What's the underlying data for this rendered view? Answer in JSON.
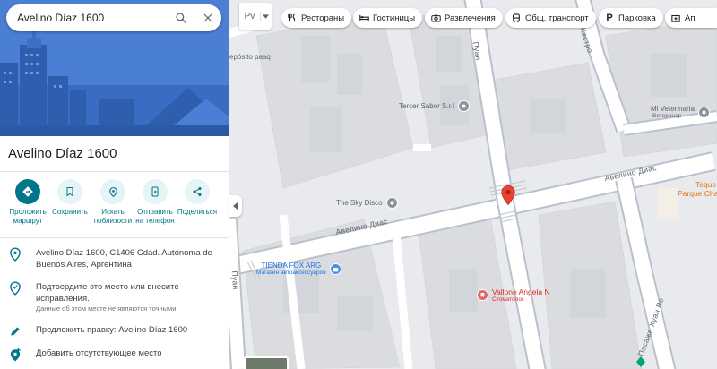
{
  "search": {
    "query": "Avelino Díaz 1600"
  },
  "place": {
    "title": "Avelino Díaz 1600"
  },
  "actions": [
    {
      "label": "Проложить\nмаршрут",
      "icon": "directions-icon"
    },
    {
      "label": "Сохранить",
      "icon": "bookmark-icon"
    },
    {
      "label": "Искать\nпоблизости",
      "icon": "nearby-icon"
    },
    {
      "label": "Отправить\nна телефон",
      "icon": "send-to-phone-icon"
    },
    {
      "label": "Поделиться",
      "icon": "share-icon"
    }
  ],
  "info": {
    "address": "Avelino Díaz 1600, C1406 Cdad. Autónoma de Buenos Aires, Аргентина",
    "confirm": "Подтвердите это место или внесите исправления.",
    "confirm_note": "Данные об этом месте не являются точными.",
    "suggest": "Предложить правку: Avelino Díaz 1600",
    "add_place": "Добавить отсутствующее место"
  },
  "map": {
    "layer_label": "Pv",
    "chips": [
      {
        "label": "Рестораны",
        "icon": "restaurant-icon"
      },
      {
        "label": "Гостиницы",
        "icon": "hotel-icon"
      },
      {
        "label": "Развлечения",
        "icon": "camera-icon"
      },
      {
        "label": "Общ. транспорт",
        "icon": "transit-icon"
      },
      {
        "label": "Парковка",
        "icon": "parking-icon"
      },
      {
        "label": "Ап",
        "icon": "pharmacy-icon"
      }
    ],
    "streets": {
      "avelino_left": "Авелино Диас",
      "avelino_right": "Авелино Диас",
      "puan": "Пуан",
      "castro": "Кастро",
      "pasaje": "Пасаже Хуан Ве",
      "left_edge": "Пуан"
    },
    "labels": {
      "deposito": "epósito paaq",
      "tercer": "Tercer Sabor S.r.l",
      "vet": "Mi Veterinaria",
      "vet_sub": "Ветеринар",
      "disco": "The Sky Disco",
      "tienda": "TIENDA FOX ARG",
      "tienda_sub": "Магазин автоаксессуаров",
      "vallone": "Vallone Angela N",
      "vallone_sub": "Стоматолог",
      "teque": "Teque",
      "parque": "Parque Cha"
    },
    "colors": {
      "accent": "#00768a",
      "pin": "#ea4335",
      "shop": "#4a90e2",
      "dentist": "#e06666",
      "park": "#e8710a"
    }
  }
}
